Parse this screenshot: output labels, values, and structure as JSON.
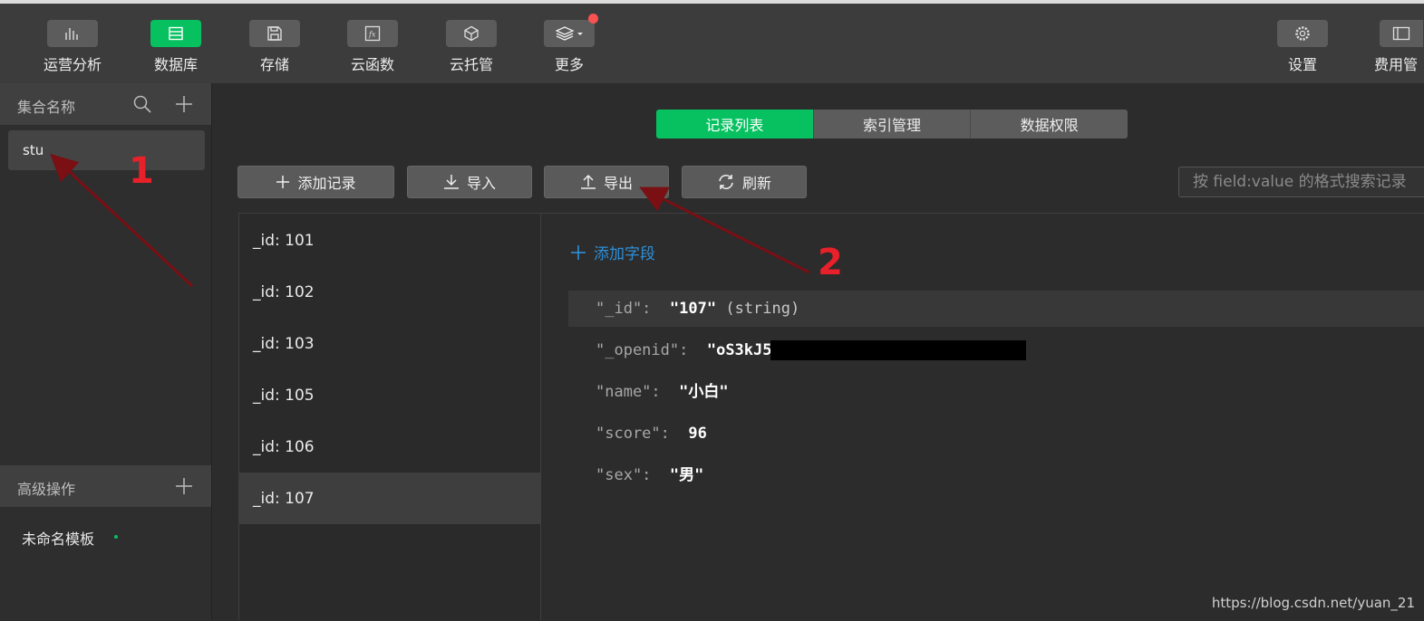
{
  "toolbar": {
    "items": [
      {
        "label": "运营分析",
        "icon": "bar-chart-icon"
      },
      {
        "label": "数据库",
        "icon": "database-icon",
        "active": true
      },
      {
        "label": "存储",
        "icon": "save-icon"
      },
      {
        "label": "云函数",
        "icon": "function-icon"
      },
      {
        "label": "云托管",
        "icon": "cube-icon"
      },
      {
        "label": "更多",
        "icon": "layers-icon"
      }
    ],
    "settings_label": "设置",
    "billing_label": "费用管"
  },
  "sidebar": {
    "collections_title": "集合名称",
    "collections": [
      "stu"
    ],
    "advanced_title": "高级操作",
    "template_name": "未命名模板"
  },
  "tabs": [
    {
      "label": "记录列表",
      "active": true
    },
    {
      "label": "索引管理"
    },
    {
      "label": "数据权限"
    }
  ],
  "actions": {
    "add_record": "添加记录",
    "import": "导入",
    "export": "导出",
    "refresh": "刷新",
    "search_placeholder": "按 field:value 的格式搜索记录"
  },
  "records": [
    "_id: 101",
    "_id: 102",
    "_id: 103",
    "_id: 105",
    "_id: 106",
    "_id: 107"
  ],
  "selected_record_index": 5,
  "detail": {
    "add_field": "添加字段",
    "fields": [
      {
        "key": "\"_id\":",
        "value": "\"107\"",
        "type": "(string)"
      },
      {
        "key": "\"_openid\":",
        "value": "\"oS3kJ5"
      },
      {
        "key": "\"name\":",
        "value": "\"小白\""
      },
      {
        "key": "\"score\":",
        "value": "96"
      },
      {
        "key": "\"sex\":",
        "value": "\"男\""
      }
    ]
  },
  "annotations": [
    "1",
    "2"
  ],
  "watermark": "https://blog.csdn.net/yuan_21",
  "colors": {
    "accent": "#07c160",
    "annotation": "#e8202a",
    "link": "#2e8fd8"
  }
}
